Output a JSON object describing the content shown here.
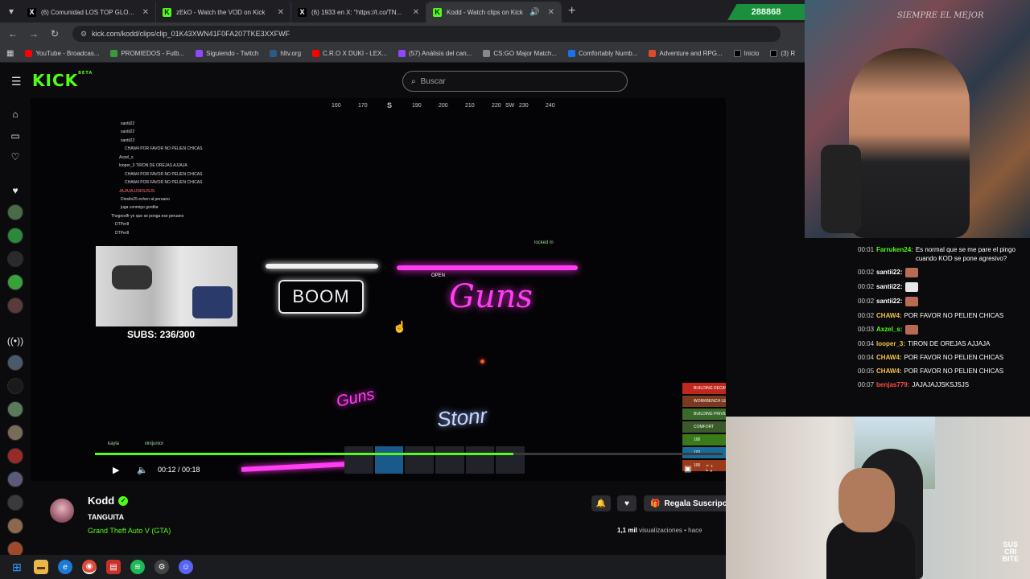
{
  "browser": {
    "tabs": [
      {
        "title": "(6) Comunidad LOS TOP GLOBAL",
        "favicon": "X",
        "favicon_color": "#000000",
        "active": false
      },
      {
        "title": "zEkO - Watch the VOD on Kick",
        "favicon": "K",
        "favicon_color": "#53fc18",
        "active": false
      },
      {
        "title": "(6) 1933 en X: \"https://t.co/TN...",
        "favicon": "X",
        "favicon_color": "#000000",
        "active": false
      },
      {
        "title": "Kodd - Watch clips on Kick",
        "favicon": "K",
        "favicon_color": "#53fc18",
        "active": true
      }
    ],
    "url": "kick.com/kodd/clips/clip_01K43XWN41F0FA207TKE3XXFWF",
    "bookmarks": [
      {
        "label": "YouTube - Broadcas...",
        "color": "#ff0000"
      },
      {
        "label": "PROMIEDOS - Futb...",
        "color": "#3a9a3a"
      },
      {
        "label": "Siguiendo - Twitch",
        "color": "#9146ff"
      },
      {
        "label": "hltv.org",
        "color": "#2a5a8a"
      },
      {
        "label": "C.R.O X DUKI - LEX...",
        "color": "#ff0000"
      },
      {
        "label": "(57) Análisis del can...",
        "color": "#9146ff"
      },
      {
        "label": "CS:GO Major Match...",
        "color": "#888888"
      },
      {
        "label": "Comfortably Numb...",
        "color": "#1a73e8"
      },
      {
        "label": "Adventure and RPG...",
        "color": "#e04a2a"
      },
      {
        "label": "Inicio",
        "color": "#000000"
      },
      {
        "label": "(3) R",
        "color": "#000000"
      }
    ],
    "viewer_count": "288868"
  },
  "kick": {
    "logo": "KICK",
    "logo_sup": "BETA",
    "search_placeholder": "Buscar",
    "accent": "#53fc18"
  },
  "video": {
    "compass": [
      "160",
      "170",
      "S",
      "190",
      "200",
      "210",
      "220",
      "SW",
      "230",
      "240"
    ],
    "overlay_chat": [
      "santii22",
      "santii22",
      "santii22",
      "CHAW4  POR FAVOR NO PELIEN CHICAS",
      "Axzel_s",
      "looper_3  TIRON DE OREJAS AJJAJA",
      "CHAW4  POR FAVOR NO PELIEN CHICAS",
      "CHAW4  POR FAVOR NO PELIEN CHICAS",
      "JAJAJAJJSKSJSJS",
      "Diosito25  echen al peruano",
      "juga conmigo gordita",
      "Thegoodfr  yo que se ponga ese peruano",
      "DTPer8",
      "DTPer8"
    ],
    "subs_label": "SUBS: 236/300",
    "neon_boom": "BOOM",
    "neon_guns": "Guns",
    "neon_open": "OPEN",
    "neon_stonr": "Stonr",
    "locked_in": "locked in",
    "hud": [
      {
        "label": "BUILDING DECAYING",
        "color": "#c0281e"
      },
      {
        "label": "WORKBENCH LEVEL 3",
        "color": "#7a3a1e"
      },
      {
        "label": "BUILDING PRIVILEGE",
        "color": "#3a6a2a"
      },
      {
        "label": "COMFORT",
        "color": "#3a5a2a"
      },
      {
        "label": "100",
        "color": "#3a7a1a"
      },
      {
        "label": "102",
        "color": "#1a6a9a"
      },
      {
        "label": "100",
        "color": "#9a3a1a"
      }
    ],
    "names": [
      "kayla",
      "vinijunior"
    ],
    "time": "00:12 / 00:18",
    "progress": 0.667
  },
  "streamer": {
    "name": "Kodd",
    "title": "TANGUITA",
    "game": "Grand Theft Auto V (GTA)",
    "gift_label": "Regala Suscripc",
    "views": "1,1 mil",
    "views_suffix": " visualizaciones",
    "ago": " • hace"
  },
  "chat": [
    {
      "time": "00:01",
      "user": "Farruken24:",
      "color": "#53fc18",
      "text": "Es normal que se me pare el pingo cuando KOD se pone agresivo?"
    },
    {
      "time": "00:02",
      "user": "santii22:",
      "color": "#ffffff",
      "text": "",
      "emote": true
    },
    {
      "time": "00:02",
      "user": "santii22:",
      "color": "#ffffff",
      "text": "",
      "emote": true
    },
    {
      "time": "00:02",
      "user": "santii22:",
      "color": "#ffffff",
      "text": "",
      "emote": true
    },
    {
      "time": "00:02",
      "user": "CHAW4:",
      "color": "#f2c14e",
      "text": "POR FAVOR NO PELIEN CHICAS"
    },
    {
      "time": "00:03",
      "user": "Axzel_s:",
      "color": "#53fc18",
      "text": "",
      "emote": true
    },
    {
      "time": "00:04",
      "user": "looper_3:",
      "color": "#f2c14e",
      "text": "TIRON DE OREJAS AJJAJA"
    },
    {
      "time": "00:04",
      "user": "CHAW4:",
      "color": "#f2c14e",
      "text": "POR FAVOR NO PELIEN CHICAS"
    },
    {
      "time": "00:05",
      "user": "CHAW4:",
      "color": "#f2c14e",
      "text": "POR FAVOR NO PELIEN CHICAS"
    },
    {
      "time": "00:07",
      "user": "benjas779:",
      "color": "#ff4a4a",
      "text": "JAJAJAJJSKSJSJS"
    }
  ],
  "cam1_wall_text": "SIEMPRE EL MEJOR",
  "cam2_subscribe": [
    "SUS",
    "CRI",
    "BITE"
  ]
}
